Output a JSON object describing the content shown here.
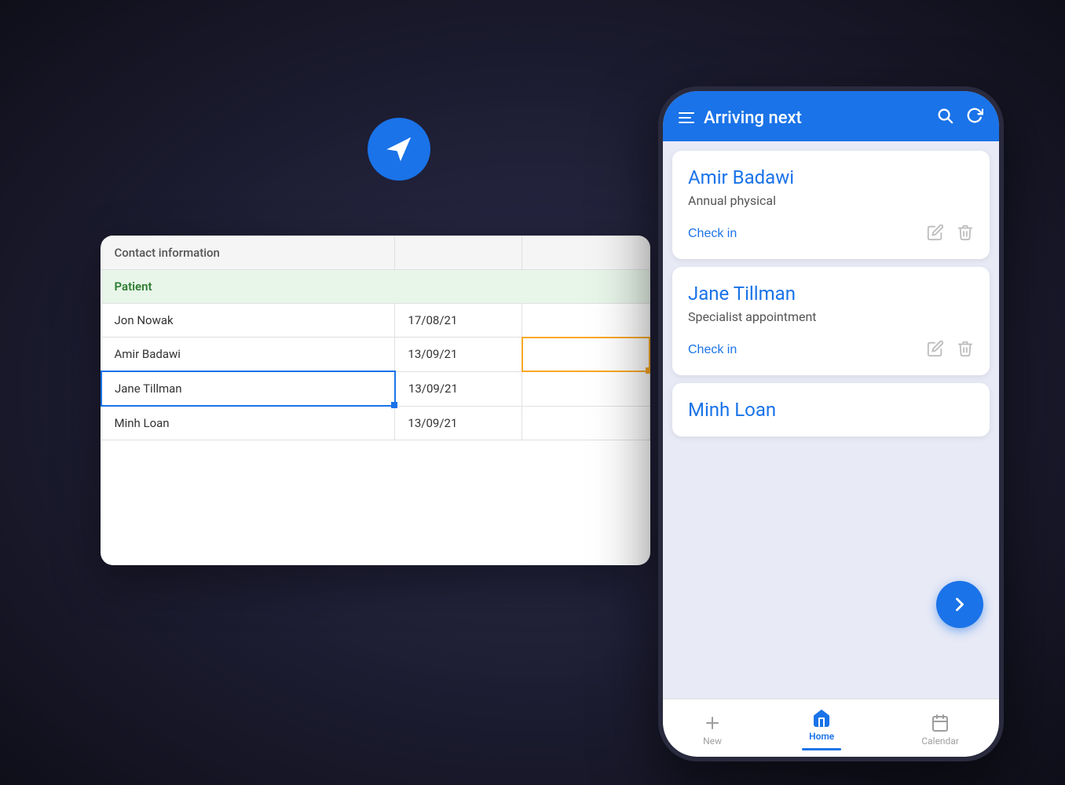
{
  "app": {
    "title": "Arriving next"
  },
  "paperPlane": {
    "alt": "Paper plane logo"
  },
  "spreadsheet": {
    "headerRow": {
      "col1": "Contact information",
      "col2": "",
      "col3": ""
    },
    "groupRow": {
      "label": "Patient"
    },
    "rows": [
      {
        "name": "Jon Nowak",
        "date": "17/08/21",
        "extra": ""
      },
      {
        "name": "Amir Badawi",
        "date": "13/09/21",
        "extra": ""
      },
      {
        "name": "Jane Tillman",
        "date": "13/09/21",
        "extra": ""
      },
      {
        "name": "Minh Loan",
        "date": "13/09/21",
        "extra": ""
      }
    ]
  },
  "patients": [
    {
      "name": "Amir Badawi",
      "appointment": "Annual physical",
      "checkInLabel": "Check in"
    },
    {
      "name": "Jane Tillman",
      "appointment": "Specialist appointment",
      "checkInLabel": "Check in"
    },
    {
      "name": "Minh Loan",
      "appointment": "",
      "checkInLabel": ""
    }
  ],
  "bottomNav": {
    "new": "New",
    "home": "Home",
    "calendar": "Calendar"
  },
  "icons": {
    "hamburger": "hamburger-icon",
    "search": "⌕",
    "refresh": "↻",
    "edit": "✏",
    "delete": "🗑",
    "checkin": "➡",
    "plus": "+",
    "home": "⌂",
    "calendarNav": "▦"
  },
  "colors": {
    "blue": "#1a73e8",
    "green": "#2e7d32",
    "lightGreen": "#e8f5e9",
    "yellow": "#f9a825",
    "white": "#ffffff",
    "lightBlue": "#e8eaf6"
  }
}
